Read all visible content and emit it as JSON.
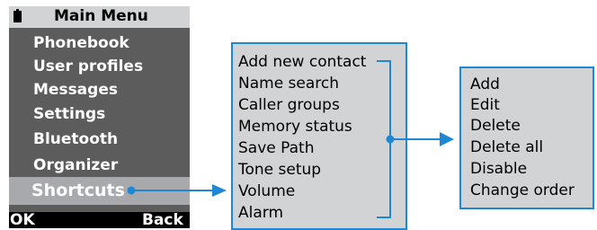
{
  "phone": {
    "title": "Main Menu",
    "items": [
      "Phonebook",
      "User profiles",
      "Messages",
      "Settings",
      "Bluetooth",
      "Organizer"
    ],
    "selected": "Shortcuts",
    "softkey_left": "OK",
    "softkey_right": "Back"
  },
  "submenu1": {
    "items": [
      "Add new contact",
      "Name search",
      "Caller groups",
      "Memory status",
      "Save Path",
      "Tone setup",
      "Volume",
      "Alarm"
    ]
  },
  "submenu2": {
    "items": [
      "Add",
      "Edit",
      "Delete",
      "Delete all",
      "Disable",
      "Change order"
    ]
  },
  "colors": {
    "connector": "#1e88d4",
    "phone_body": "#5c5c5c",
    "box_fill": "#d1d3d4"
  }
}
